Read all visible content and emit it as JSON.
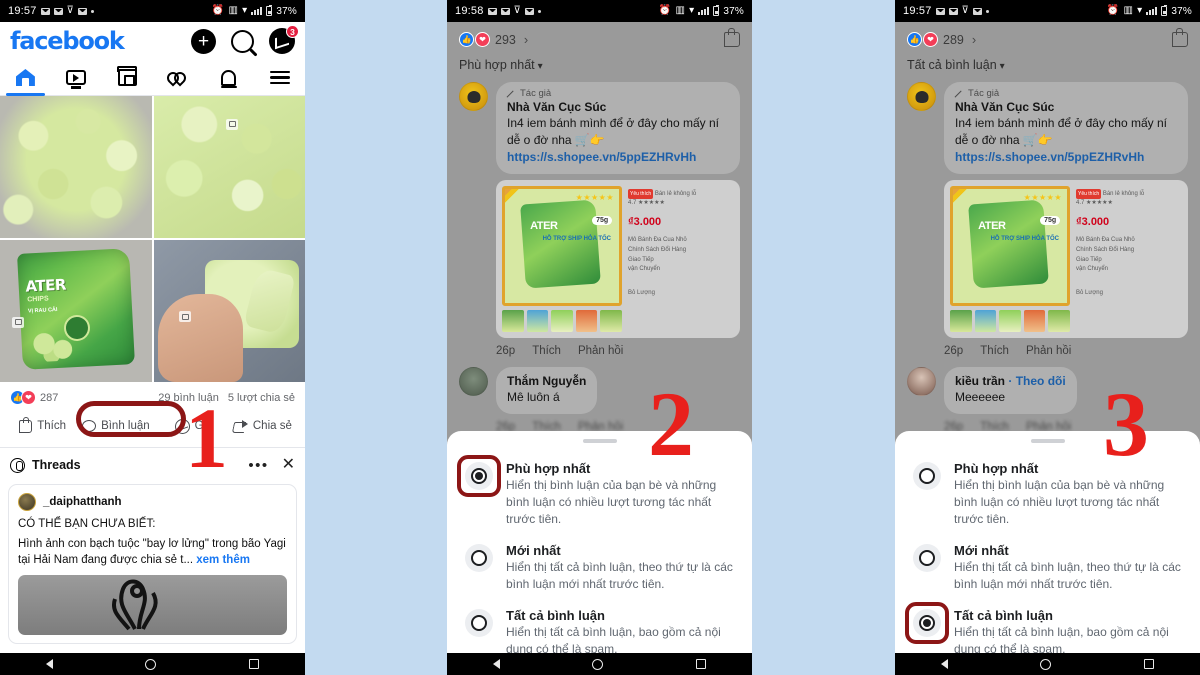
{
  "background_color": "#c3daf0",
  "annotations": [
    {
      "label": "1",
      "color": "#e8201c"
    },
    {
      "label": "2",
      "color": "#e8201c"
    },
    {
      "label": "3",
      "color": "#e8201c"
    }
  ],
  "panel1": {
    "status_bar": {
      "time": "19:57",
      "battery": "37%",
      "icons": [
        "envelope-icon",
        "envelope-icon",
        "wifi-weak-icon",
        "envelope-icon",
        "dot-icon",
        "alarm-icon",
        "vibrate-icon",
        "wifi-icon",
        "signal-icon",
        "battery-icon"
      ]
    },
    "header": {
      "logo": "facebook",
      "logo_color": "#1877f2",
      "messenger_badge": "3"
    },
    "tabs": [
      {
        "name": "home",
        "icon": "home-icon",
        "active": true
      },
      {
        "name": "video",
        "icon": "video-icon",
        "active": false
      },
      {
        "name": "marketplace",
        "icon": "shop-icon",
        "active": false
      },
      {
        "name": "dating",
        "icon": "hearts-icon",
        "active": false
      },
      {
        "name": "notifications",
        "icon": "bell-icon",
        "active": false
      },
      {
        "name": "menu",
        "icon": "hamburger-menu-icon",
        "active": false
      }
    ],
    "post": {
      "reaction_count": "287",
      "comment_count": "29 bình luận",
      "share_count": "5 lượt chia sẻ",
      "actions": [
        {
          "label": "Thích",
          "icon": "thumbs-up-icon"
        },
        {
          "label": "Bình luận",
          "icon": "comment-bubble-icon",
          "highlighted": true
        },
        {
          "label": "G",
          "icon": "messenger-icon"
        },
        {
          "label": "Chia sẻ",
          "icon": "share-arrow-icon"
        }
      ]
    },
    "threads": {
      "title": "Threads",
      "username": "_daiphatthanh",
      "headline": "CÓ THỂ BẠN CHƯA BIẾT:",
      "body": "Hình ảnh con bạch tuộc \"bay lơ lửng\" trong bão Yagi tại Hải Nam đang được chia sẻ t...",
      "more_link": "xem thêm"
    }
  },
  "panel2": {
    "status_bar": {
      "time": "19:58",
      "battery": "37%"
    },
    "reaction_count": "293",
    "sort_label": "Phù hợp nhất",
    "comment": {
      "author_tag": "Tác giả",
      "name": "Nhà Văn Cục Súc",
      "text": "In4 iem bánh mình để ở đây cho mấy ní dễ o đờ nha 🛒👉",
      "link": "https://s.shopee.vn/5ppEZHRvHh"
    },
    "product": {
      "price": "₫3.000",
      "weight": "75g",
      "badge": "Yêu thích",
      "seller": "Bán lẻ không lỗ",
      "vertical_text": "HỖ TRỢ SHIP HỎA TỐC",
      "lines": [
        "Mô Bánh Đa Cua Nhỏ",
        "Chính Sách Đổi Hàng",
        "Giao Tiếp",
        "vận Chuyển",
        "Bỏ Lượng"
      ]
    },
    "meta": [
      "26p",
      "Thích",
      "Phản hồi"
    ],
    "second_comment": {
      "name": "Thắm Nguyễn",
      "text": "Mê luôn á"
    },
    "sheet_options": [
      {
        "title": "Phù hợp nhất",
        "desc": "Hiển thị bình luận của bạn bè và những bình luận có nhiều lượt tương tác nhất trước tiên.",
        "selected": true,
        "highlighted": true
      },
      {
        "title": "Mới nhất",
        "desc": "Hiển thị tất cả bình luận, theo thứ tự là các bình luận mới nhất trước tiên.",
        "selected": false,
        "highlighted": false
      },
      {
        "title": "Tất cả bình luận",
        "desc": "Hiển thị tất cả bình luận, bao gồm cả nội dung có thể là spam.",
        "selected": false,
        "highlighted": false
      }
    ]
  },
  "panel3": {
    "status_bar": {
      "time": "19:57",
      "battery": "37%"
    },
    "reaction_count": "289",
    "sort_label": "Tất cả bình luận",
    "comment": {
      "author_tag": "Tác giả",
      "name": "Nhà Văn Cục Súc",
      "text": "In4 iem bánh mình để ở đây cho mấy ní dễ o đờ nha 🛒👉",
      "link": "https://s.shopee.vn/5ppEZHRvHh"
    },
    "product": {
      "price": "₫3.000",
      "weight": "75g",
      "badge": "Yêu thích",
      "seller": "Bán lẻ không lỗ",
      "vertical_text": "HỖ TRỢ SHIP HỎA TỐC",
      "lines": [
        "Mô Bánh Đa Cua Nhỏ",
        "Chính Sách Đổi Hàng",
        "Giao Tiếp",
        "vận Chuyển",
        "Bỏ Lượng"
      ]
    },
    "meta": [
      "26p",
      "Thích",
      "Phản hồi"
    ],
    "second_comment": {
      "name": "kiều trần",
      "follow": "Theo dõi",
      "text": "Meeeeee"
    },
    "sheet_options": [
      {
        "title": "Phù hợp nhất",
        "desc": "Hiển thị bình luận của bạn bè và những bình luận có nhiều lượt tương tác nhất trước tiên.",
        "selected": false,
        "highlighted": false
      },
      {
        "title": "Mới nhất",
        "desc": "Hiển thị tất cả bình luận, theo thứ tự là các bình luận mới nhất trước tiên.",
        "selected": false,
        "highlighted": false
      },
      {
        "title": "Tất cả bình luận",
        "desc": "Hiển thị tất cả bình luận, bao gồm cả nội dung có thể là spam.",
        "selected": true,
        "highlighted": true
      }
    ]
  },
  "nav_bar": {
    "back": "back-triangle-icon",
    "home": "home-circle-icon",
    "recents": "recents-square-icon"
  }
}
